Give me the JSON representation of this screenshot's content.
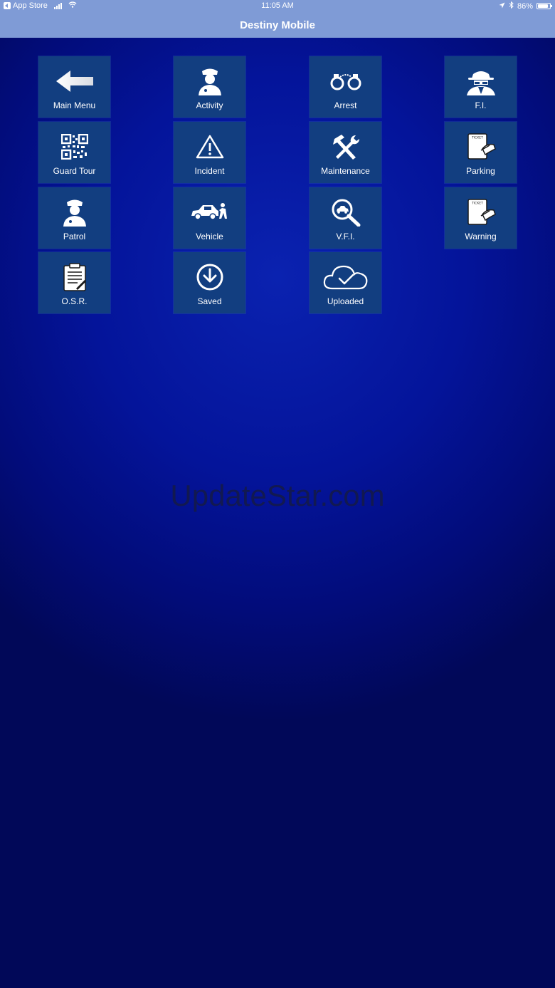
{
  "status_bar": {
    "back_app": "App Store",
    "time": "11:05 AM",
    "battery": "86%",
    "battery_level": 0.86
  },
  "nav": {
    "title": "Destiny Mobile"
  },
  "tiles": [
    {
      "label": "Main Menu",
      "icon": "back-arrow-icon"
    },
    {
      "label": "Activity",
      "icon": "officer-icon"
    },
    {
      "label": "Arrest",
      "icon": "handcuffs-icon"
    },
    {
      "label": "F.I.",
      "icon": "spy-icon"
    },
    {
      "label": "Guard Tour",
      "icon": "qr-code-icon"
    },
    {
      "label": "Incident",
      "icon": "warning-triangle-icon"
    },
    {
      "label": "Maintenance",
      "icon": "tools-icon"
    },
    {
      "label": "Parking",
      "icon": "ticket-icon"
    },
    {
      "label": "Patrol",
      "icon": "officer-icon"
    },
    {
      "label": "Vehicle",
      "icon": "car-inspection-icon"
    },
    {
      "label": "V.F.I.",
      "icon": "car-search-icon"
    },
    {
      "label": "Warning",
      "icon": "ticket-icon"
    },
    {
      "label": "O.S.R.",
      "icon": "clipboard-icon"
    },
    {
      "label": "Saved",
      "icon": "download-circle-icon"
    },
    {
      "label": "Uploaded",
      "icon": "cloud-check-icon"
    }
  ],
  "watermark": "UpdateStar.com",
  "colors": {
    "header": "#7f9bd6",
    "tile": "#123e80",
    "background": "#04149a"
  }
}
